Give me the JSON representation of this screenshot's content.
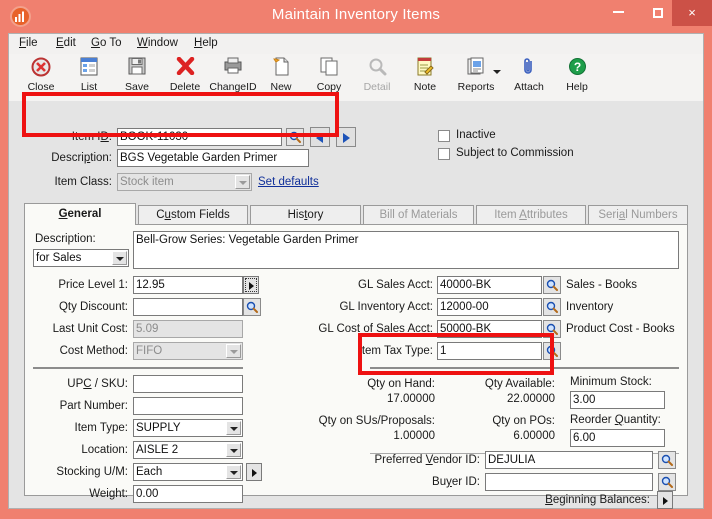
{
  "window": {
    "title": "Maintain Inventory Items",
    "app_icon": "chart-icon",
    "controls": {
      "minimize": "minimize-icon",
      "maximize": "maximize-icon",
      "close": "×"
    }
  },
  "menubar": [
    {
      "label": "File",
      "accel": "F"
    },
    {
      "label": "Edit",
      "accel": "E"
    },
    {
      "label": "Go To",
      "accel": "G"
    },
    {
      "label": "Window",
      "accel": "W"
    },
    {
      "label": "Help",
      "accel": "H"
    }
  ],
  "toolbar": [
    {
      "label": "Close",
      "icon": "close-circle-icon",
      "disabled": false
    },
    {
      "label": "List",
      "icon": "list-icon",
      "disabled": false
    },
    {
      "label": "Save",
      "icon": "save-disk-icon",
      "disabled": false
    },
    {
      "label": "Delete",
      "icon": "delete-x-icon",
      "disabled": false
    },
    {
      "label": "ChangeID",
      "icon": "change-id-icon",
      "disabled": false
    },
    {
      "label": "New",
      "icon": "new-page-icon",
      "disabled": false
    },
    {
      "label": "Copy",
      "icon": "copy-pages-icon",
      "disabled": false
    },
    {
      "label": "Detail",
      "icon": "magnifier-icon",
      "disabled": true
    },
    {
      "label": "Note",
      "icon": "note-pencil-icon",
      "disabled": false
    },
    {
      "label": "Reports",
      "icon": "reports-icon",
      "disabled": false,
      "has_dropdown": true
    },
    {
      "label": "Attach",
      "icon": "paperclip-icon",
      "disabled": false
    },
    {
      "label": "Help",
      "icon": "help-question-icon",
      "disabled": false
    }
  ],
  "header": {
    "item_id_label": "Item ID:",
    "item_id_value": "BOOK-11030",
    "description_label": "Description:",
    "description_value": "BGS Vegetable Garden Primer",
    "item_class_label": "Item Class:",
    "item_class_value": "Stock item",
    "set_defaults_link": "Set defaults",
    "lookup_icon": "magnifier-icon",
    "prev_icon": "prev-arrow-icon",
    "next_icon": "next-arrow-icon",
    "checkboxes": [
      {
        "label": "Inactive",
        "checked": false
      },
      {
        "label": "Subject to Commission",
        "checked": false
      }
    ]
  },
  "tabs": [
    {
      "label": "General",
      "active": true,
      "disabled": false
    },
    {
      "label": "Custom Fields",
      "active": false,
      "disabled": false
    },
    {
      "label": "History",
      "active": false,
      "disabled": false
    },
    {
      "label": "Bill of Materials",
      "active": false,
      "disabled": true
    },
    {
      "label": "Item Attributes",
      "active": false,
      "disabled": true
    },
    {
      "label": "Serial Numbers",
      "active": false,
      "disabled": true
    }
  ],
  "general": {
    "description_label": "Description:",
    "description_scope": "for Sales",
    "description_text": "Bell-Grow Series: Vegetable Garden Primer",
    "price_level_label": "Price Level 1:",
    "price_level_value": "12.95",
    "qty_discount_label": "Qty Discount:",
    "qty_discount_value": "",
    "last_unit_cost_label": "Last Unit Cost:",
    "last_unit_cost_value": "5.09",
    "cost_method_label": "Cost Method:",
    "cost_method_value": "FIFO",
    "gl_sales_acct_label": "GL Sales Acct:",
    "gl_sales_acct_value": "40000-BK",
    "gl_sales_acct_desc": "Sales - Books",
    "gl_inventory_acct_label": "GL Inventory Acct:",
    "gl_inventory_acct_value": "12000-00",
    "gl_inventory_acct_desc": "Inventory",
    "gl_cost_of_sales_label": "GL Cost of Sales Acct:",
    "gl_cost_of_sales_value": "50000-BK",
    "gl_cost_of_sales_desc": "Product Cost - Books",
    "item_tax_type_label": "Item Tax Type:",
    "item_tax_type_value": "1",
    "upc_sku_label": "UPC / SKU:",
    "upc_sku_value": "",
    "part_number_label": "Part Number:",
    "part_number_value": "",
    "item_type_label": "Item Type:",
    "item_type_value": "SUPPLY",
    "location_label": "Location:",
    "location_value": "AISLE 2",
    "stocking_um_label": "Stocking U/M:",
    "stocking_um_value": "Each",
    "weight_label": "Weight:",
    "weight_value": "0.00",
    "qty_on_hand_label": "Qty on Hand:",
    "qty_on_hand_value": "17.00000",
    "qty_available_label": "Qty Available:",
    "qty_available_value": "22.00000",
    "qty_sus_proposals_label": "Qty on SUs/Proposals:",
    "qty_sus_proposals_value": "1.00000",
    "qty_on_pos_label": "Qty on POs:",
    "qty_on_pos_value": "6.00000",
    "minimum_stock_label": "Minimum Stock:",
    "minimum_stock_value": "3.00",
    "reorder_quantity_label": "Reorder Quantity:",
    "reorder_quantity_value": "6.00",
    "preferred_vendor_label": "Preferred Vendor ID:",
    "preferred_vendor_value": "DEJULIA",
    "buyer_id_label": "Buyer ID:",
    "buyer_id_value": "",
    "beginning_balances_label": "Beginning Balances:"
  },
  "annotations": {
    "highlight_color": "#ee1111",
    "boxes": [
      {
        "name": "item-id-description-highlight"
      },
      {
        "name": "qty-on-hand-available-highlight"
      }
    ]
  }
}
